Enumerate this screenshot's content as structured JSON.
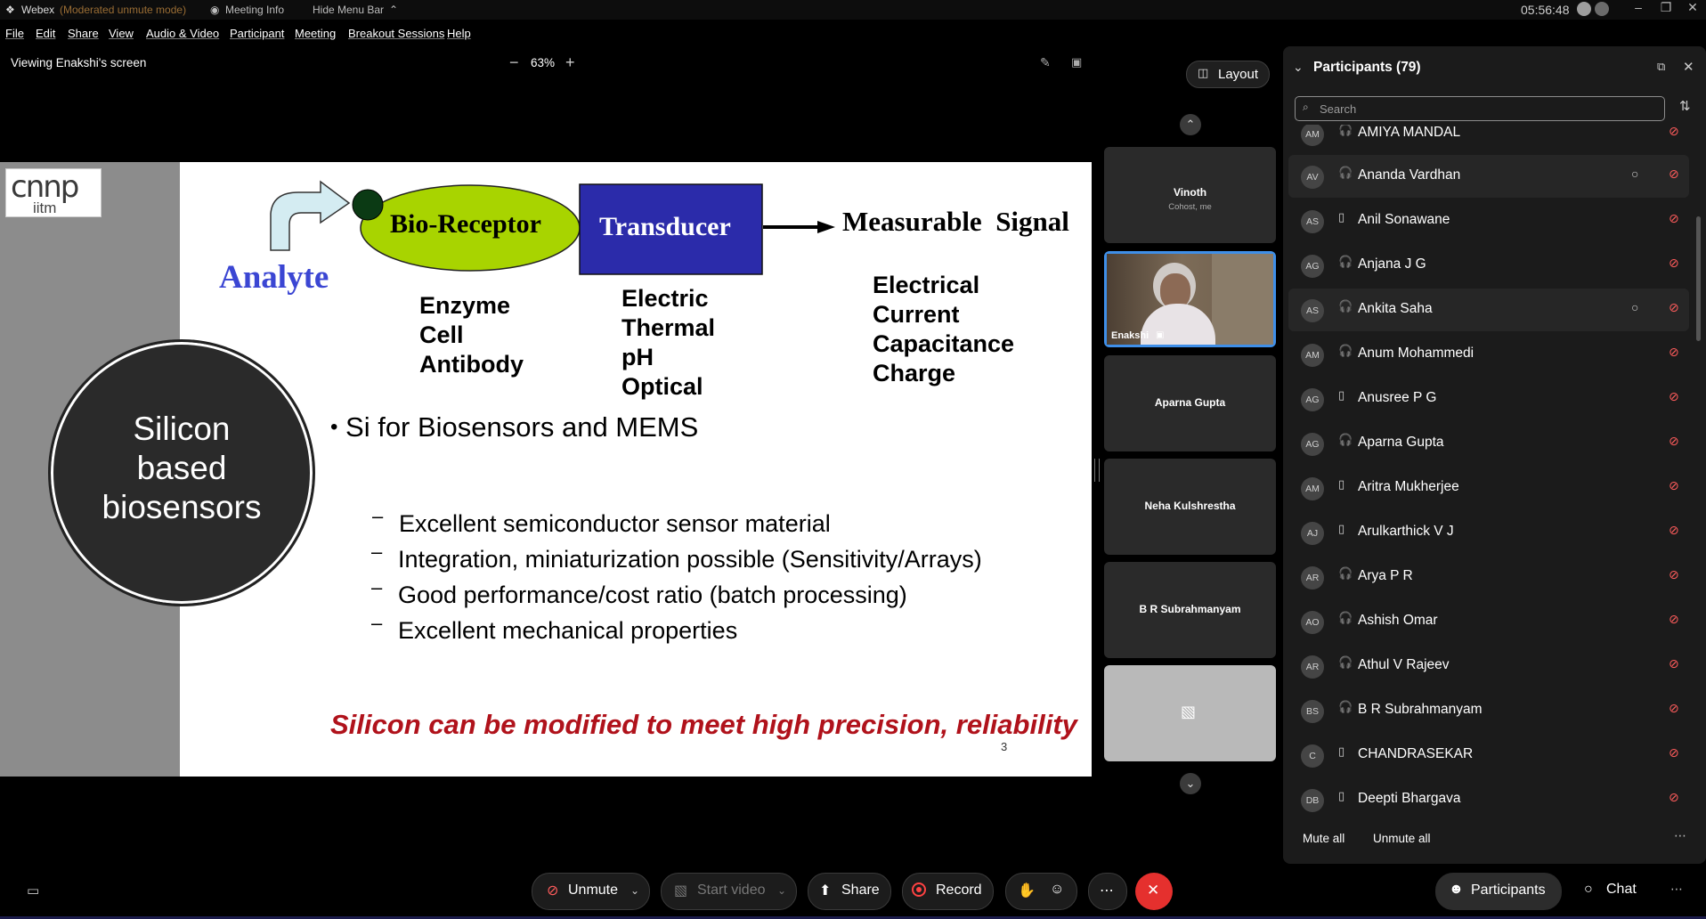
{
  "titlebar": {
    "app": "Webex",
    "mode": "(Moderated unmute mode)",
    "meeting_info": "Meeting Info",
    "hide_menu": "Hide Menu Bar",
    "clock": "05:56:48"
  },
  "menu": [
    "File",
    "Edit",
    "Share",
    "View",
    "Audio & Video",
    "Participant",
    "Meeting",
    "Breakout Sessions",
    "Help"
  ],
  "share": {
    "viewing": "Viewing Enakshi's screen",
    "zoom": "63%"
  },
  "layout_button": "Layout",
  "slide": {
    "logo_top": "cnnp",
    "logo_bottom": "iitm",
    "analyte": "Analyte",
    "bio_receptor": "Bio-Receptor",
    "transducer": "Transducer",
    "measurable": "Measurable  Signal",
    "receptor_types": "Enzyme\nCell\nAntibody",
    "transducer_types": "Electric\nThermal\npH\nOptical",
    "signal_types": "Electrical\nCurrent\nCapacitance\nCharge",
    "circle_text": "Silicon\nbased\nbiosensors",
    "bullet": "Si for Biosensors and MEMS",
    "sub_bullets": [
      "Excellent semiconductor sensor material",
      "Integration, miniaturization possible (Sensitivity/Arrays)",
      "Good performance/cost ratio (batch processing)",
      "Excellent mechanical properties"
    ],
    "footer": "Silicon can be modified to meet high precision, reliability",
    "page_number": "3"
  },
  "video_tiles": [
    {
      "name": "Vinoth",
      "sub": "Cohost, me"
    },
    {
      "name": "Enakshi"
    },
    {
      "name": "Aparna Gupta"
    },
    {
      "name": "Neha Kulshrestha"
    },
    {
      "name": "B R Subrahmanyam"
    }
  ],
  "participants_panel": {
    "title": "Participants (79)",
    "search_placeholder": "Search",
    "list": [
      {
        "initials": "AM",
        "name": "AMIYA MANDAL",
        "device": "headset"
      },
      {
        "initials": "AV",
        "name": "Ananda Vardhan",
        "device": "headset",
        "chat": true
      },
      {
        "initials": "AS",
        "name": "Anil Sonawane",
        "device": "phone"
      },
      {
        "initials": "AG",
        "name": "Anjana J G",
        "device": "headset"
      },
      {
        "initials": "AS",
        "name": "Ankita Saha",
        "device": "headset",
        "chat": true
      },
      {
        "initials": "AM",
        "name": "Anum Mohammedi",
        "device": "headset"
      },
      {
        "initials": "AG",
        "name": "Anusree P G",
        "device": "phone"
      },
      {
        "initials": "AG",
        "name": "Aparna Gupta",
        "device": "headset"
      },
      {
        "initials": "AM",
        "name": "Aritra Mukherjee",
        "device": "phone"
      },
      {
        "initials": "AJ",
        "name": "Arulkarthick V J",
        "device": "phone"
      },
      {
        "initials": "AR",
        "name": "Arya P R",
        "device": "headset"
      },
      {
        "initials": "AO",
        "name": "Ashish Omar",
        "device": "headset"
      },
      {
        "initials": "AR",
        "name": "Athul V Rajeev",
        "device": "headset"
      },
      {
        "initials": "BS",
        "name": "B R Subrahmanyam",
        "device": "headset"
      },
      {
        "initials": "C",
        "name": "CHANDRASEKAR",
        "device": "phone"
      },
      {
        "initials": "DB",
        "name": "Deepti Bhargava",
        "device": "phone"
      }
    ],
    "mute_all": "Mute all",
    "unmute_all": "Unmute all"
  },
  "controls": {
    "unmute": "Unmute",
    "start_video": "Start video",
    "share": "Share",
    "record": "Record",
    "participants": "Participants",
    "chat": "Chat"
  },
  "colors": {
    "bio_receptor_fill": "#a8d400",
    "transducer_fill": "#2b2baa",
    "analyte_text": "#3b46d3",
    "footer_text": "#b0121b",
    "end_button": "#e5302e",
    "mute_red": "#ff5c5c"
  }
}
